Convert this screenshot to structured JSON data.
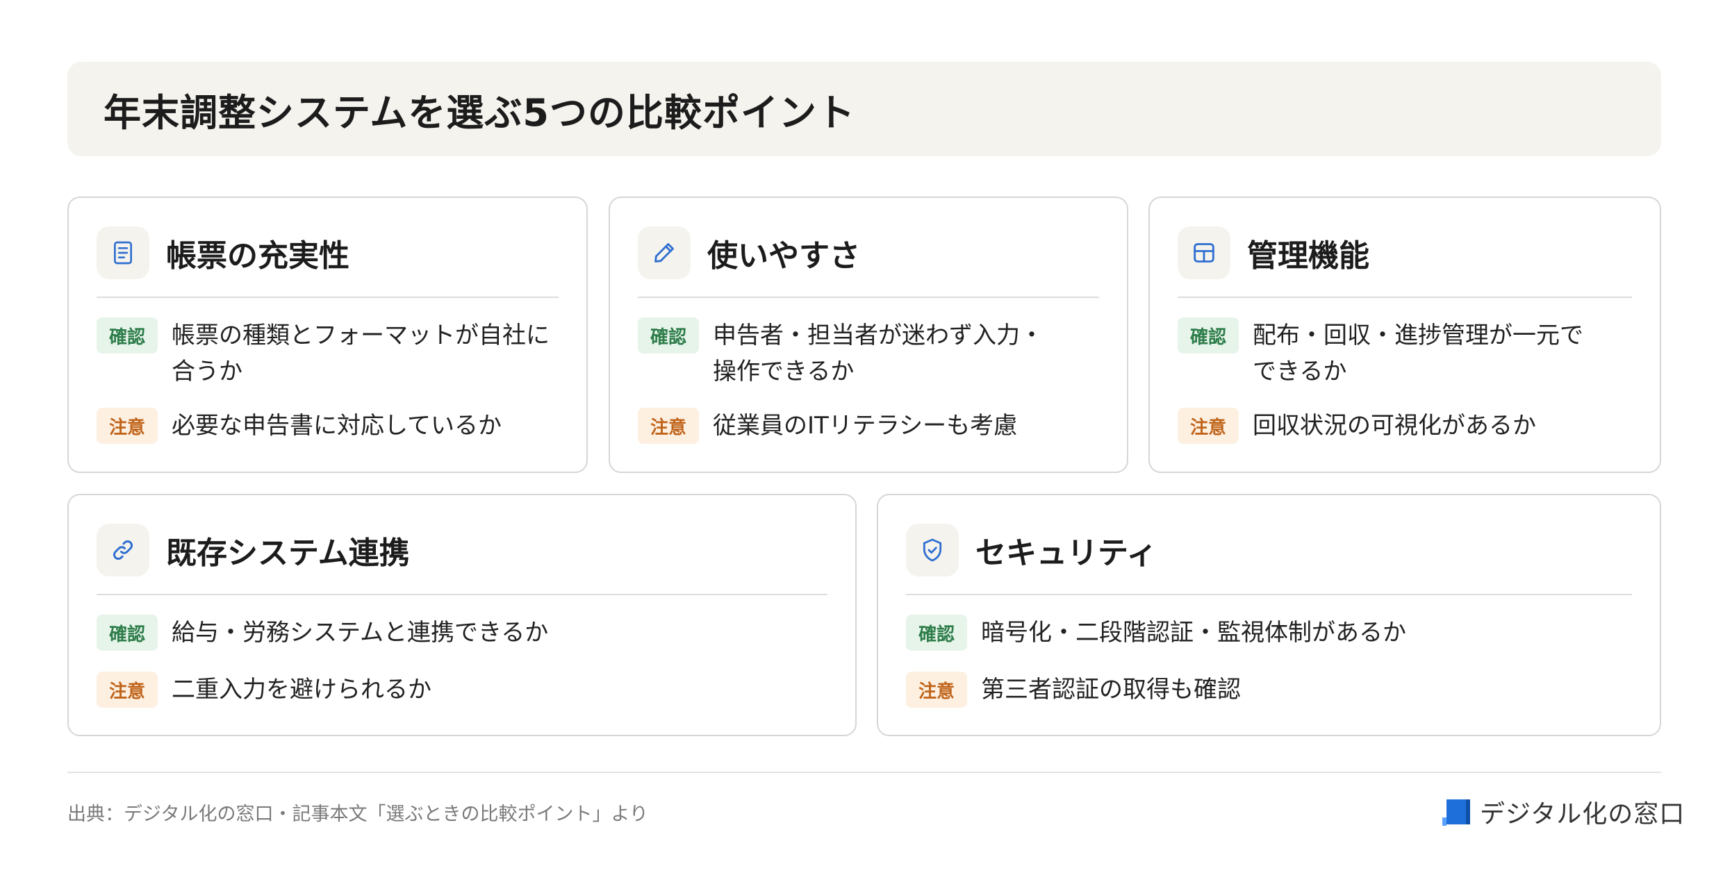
{
  "title": "年末調整システムを選ぶ5つの比較ポイント",
  "cards": [
    {
      "icon": "document-icon",
      "title": "帳票の充実性",
      "check_tag": "確認",
      "check_lines": [
        "帳票の種類とフォーマットが自社に",
        "合うか"
      ],
      "note_tag": "注意",
      "note": "必要な申告書に対応しているか"
    },
    {
      "icon": "pencil-icon",
      "title": "使いやすさ",
      "check_tag": "確認",
      "check_lines": [
        "申告者・担当者が迷わず入力・",
        "操作できるか"
      ],
      "note_tag": "注意",
      "note": "従業員のITリテラシーも考慮"
    },
    {
      "icon": "layout-grid-icon",
      "title": "管理機能",
      "check_tag": "確認",
      "check_lines": [
        "配布・回収・進捗管理が一元で",
        "できるか"
      ],
      "note_tag": "注意",
      "note": "回収状況の可視化があるか"
    },
    {
      "icon": "link-icon",
      "title": "既存システム連携",
      "check_tag": "確認",
      "check_lines": [
        "給与・労務システムと連携できるか"
      ],
      "note_tag": "注意",
      "note": "二重入力を避けられるか"
    },
    {
      "icon": "shield-check-icon",
      "title": "セキュリティ",
      "check_tag": "確認",
      "check_lines": [
        "暗号化・二段階認証・監視体制があるか"
      ],
      "note_tag": "注意",
      "note": "第三者認証の取得も確認"
    }
  ],
  "footer": {
    "source": "出典：デジタル化の窓口・記事本文「選ぶときの比較ポイント」より",
    "brand": "デジタル化の窓口"
  },
  "colors": {
    "icon_blue": "#2f6fd0",
    "check_bg": "#e6f4ea",
    "check_text": "#2e7d4a",
    "note_bg": "#fdf0e1",
    "note_text": "#c0641a",
    "title_bg": "#f5f3ee"
  }
}
